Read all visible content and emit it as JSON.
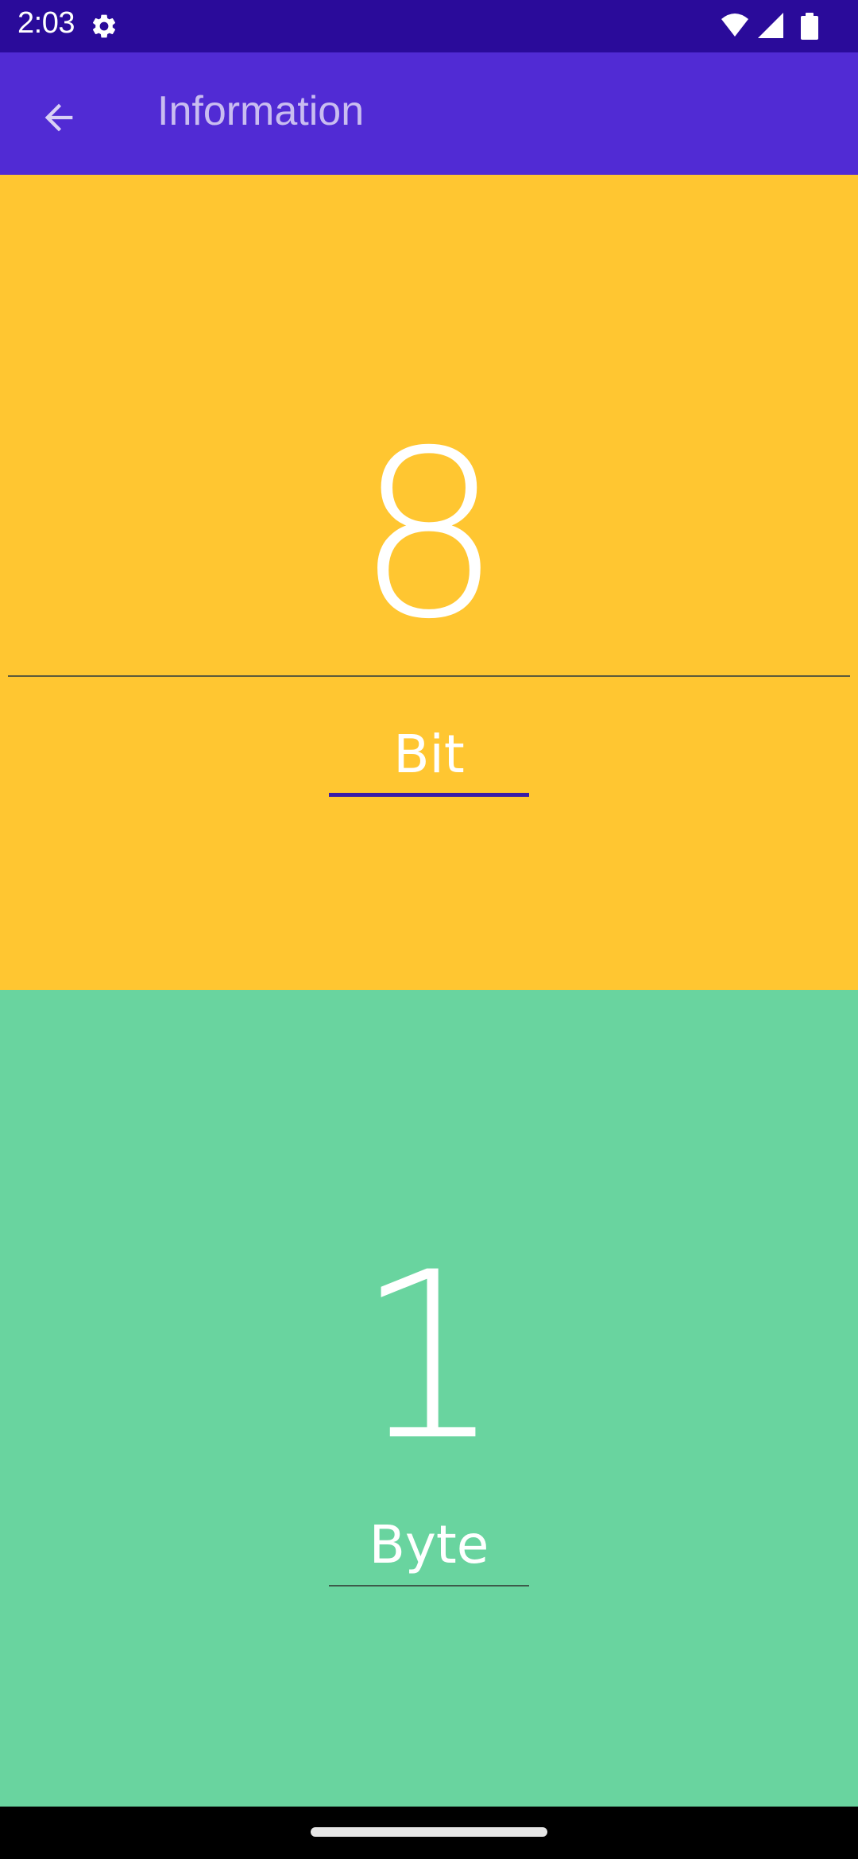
{
  "status_bar": {
    "time": "2:03",
    "icons": [
      "settings-gear-icon",
      "wifi-icon",
      "signal-icon",
      "battery-icon"
    ],
    "background": "#2a0b9a"
  },
  "app_bar": {
    "title": "Information",
    "back_icon": "arrow-left-icon",
    "background": "#512bd4"
  },
  "converter": {
    "top": {
      "value": "8",
      "unit": "Bit",
      "background": "#ffc631"
    },
    "bottom": {
      "value": "1",
      "unit": "Byte",
      "background": "#69d49f"
    }
  },
  "nav_bar": {
    "handle": "home-gesture-handle"
  }
}
